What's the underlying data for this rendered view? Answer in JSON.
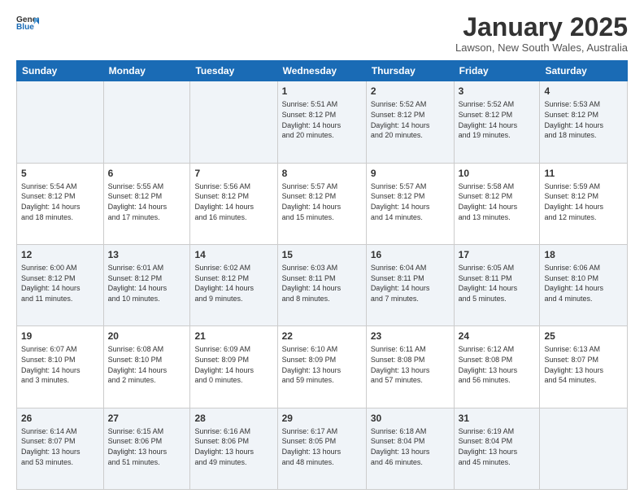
{
  "logo": {
    "line1": "General",
    "line2": "Blue"
  },
  "title": "January 2025",
  "location": "Lawson, New South Wales, Australia",
  "weekdays": [
    "Sunday",
    "Monday",
    "Tuesday",
    "Wednesday",
    "Thursday",
    "Friday",
    "Saturday"
  ],
  "weeks": [
    [
      {
        "day": "",
        "info": ""
      },
      {
        "day": "",
        "info": ""
      },
      {
        "day": "",
        "info": ""
      },
      {
        "day": "1",
        "info": "Sunrise: 5:51 AM\nSunset: 8:12 PM\nDaylight: 14 hours\nand 20 minutes."
      },
      {
        "day": "2",
        "info": "Sunrise: 5:52 AM\nSunset: 8:12 PM\nDaylight: 14 hours\nand 20 minutes."
      },
      {
        "day": "3",
        "info": "Sunrise: 5:52 AM\nSunset: 8:12 PM\nDaylight: 14 hours\nand 19 minutes."
      },
      {
        "day": "4",
        "info": "Sunrise: 5:53 AM\nSunset: 8:12 PM\nDaylight: 14 hours\nand 18 minutes."
      }
    ],
    [
      {
        "day": "5",
        "info": "Sunrise: 5:54 AM\nSunset: 8:12 PM\nDaylight: 14 hours\nand 18 minutes."
      },
      {
        "day": "6",
        "info": "Sunrise: 5:55 AM\nSunset: 8:12 PM\nDaylight: 14 hours\nand 17 minutes."
      },
      {
        "day": "7",
        "info": "Sunrise: 5:56 AM\nSunset: 8:12 PM\nDaylight: 14 hours\nand 16 minutes."
      },
      {
        "day": "8",
        "info": "Sunrise: 5:57 AM\nSunset: 8:12 PM\nDaylight: 14 hours\nand 15 minutes."
      },
      {
        "day": "9",
        "info": "Sunrise: 5:57 AM\nSunset: 8:12 PM\nDaylight: 14 hours\nand 14 minutes."
      },
      {
        "day": "10",
        "info": "Sunrise: 5:58 AM\nSunset: 8:12 PM\nDaylight: 14 hours\nand 13 minutes."
      },
      {
        "day": "11",
        "info": "Sunrise: 5:59 AM\nSunset: 8:12 PM\nDaylight: 14 hours\nand 12 minutes."
      }
    ],
    [
      {
        "day": "12",
        "info": "Sunrise: 6:00 AM\nSunset: 8:12 PM\nDaylight: 14 hours\nand 11 minutes."
      },
      {
        "day": "13",
        "info": "Sunrise: 6:01 AM\nSunset: 8:12 PM\nDaylight: 14 hours\nand 10 minutes."
      },
      {
        "day": "14",
        "info": "Sunrise: 6:02 AM\nSunset: 8:12 PM\nDaylight: 14 hours\nand 9 minutes."
      },
      {
        "day": "15",
        "info": "Sunrise: 6:03 AM\nSunset: 8:11 PM\nDaylight: 14 hours\nand 8 minutes."
      },
      {
        "day": "16",
        "info": "Sunrise: 6:04 AM\nSunset: 8:11 PM\nDaylight: 14 hours\nand 7 minutes."
      },
      {
        "day": "17",
        "info": "Sunrise: 6:05 AM\nSunset: 8:11 PM\nDaylight: 14 hours\nand 5 minutes."
      },
      {
        "day": "18",
        "info": "Sunrise: 6:06 AM\nSunset: 8:10 PM\nDaylight: 14 hours\nand 4 minutes."
      }
    ],
    [
      {
        "day": "19",
        "info": "Sunrise: 6:07 AM\nSunset: 8:10 PM\nDaylight: 14 hours\nand 3 minutes."
      },
      {
        "day": "20",
        "info": "Sunrise: 6:08 AM\nSunset: 8:10 PM\nDaylight: 14 hours\nand 2 minutes."
      },
      {
        "day": "21",
        "info": "Sunrise: 6:09 AM\nSunset: 8:09 PM\nDaylight: 14 hours\nand 0 minutes."
      },
      {
        "day": "22",
        "info": "Sunrise: 6:10 AM\nSunset: 8:09 PM\nDaylight: 13 hours\nand 59 minutes."
      },
      {
        "day": "23",
        "info": "Sunrise: 6:11 AM\nSunset: 8:08 PM\nDaylight: 13 hours\nand 57 minutes."
      },
      {
        "day": "24",
        "info": "Sunrise: 6:12 AM\nSunset: 8:08 PM\nDaylight: 13 hours\nand 56 minutes."
      },
      {
        "day": "25",
        "info": "Sunrise: 6:13 AM\nSunset: 8:07 PM\nDaylight: 13 hours\nand 54 minutes."
      }
    ],
    [
      {
        "day": "26",
        "info": "Sunrise: 6:14 AM\nSunset: 8:07 PM\nDaylight: 13 hours\nand 53 minutes."
      },
      {
        "day": "27",
        "info": "Sunrise: 6:15 AM\nSunset: 8:06 PM\nDaylight: 13 hours\nand 51 minutes."
      },
      {
        "day": "28",
        "info": "Sunrise: 6:16 AM\nSunset: 8:06 PM\nDaylight: 13 hours\nand 49 minutes."
      },
      {
        "day": "29",
        "info": "Sunrise: 6:17 AM\nSunset: 8:05 PM\nDaylight: 13 hours\nand 48 minutes."
      },
      {
        "day": "30",
        "info": "Sunrise: 6:18 AM\nSunset: 8:04 PM\nDaylight: 13 hours\nand 46 minutes."
      },
      {
        "day": "31",
        "info": "Sunrise: 6:19 AM\nSunset: 8:04 PM\nDaylight: 13 hours\nand 45 minutes."
      },
      {
        "day": "",
        "info": ""
      }
    ]
  ]
}
